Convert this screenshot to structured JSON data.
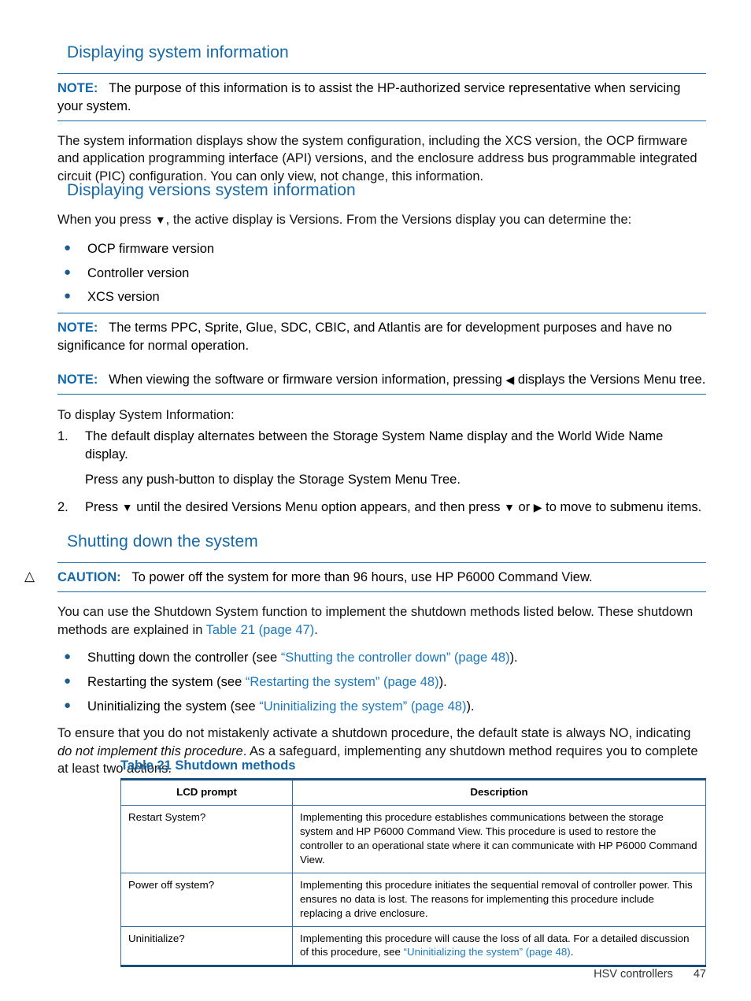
{
  "sections": [
    {
      "heading": "Displaying system information",
      "note1": {
        "label": "NOTE:",
        "text": "The purpose of this information is to assist the HP-authorized service representative when servicing your system."
      },
      "para1": "The system information displays show the system configuration, including the XCS version, the OCP firmware and application programming interface (API) versions, and the enclosure address bus programmable integrated circuit (PIC) configuration. You can only view, not change, this information."
    },
    {
      "heading": "Displaying versions system information",
      "intro_a": "When you press ",
      "intro_icon": "▼",
      "intro_b": ", the active display is Versions. From the Versions display you can determine the:",
      "bullets": [
        "OCP firmware version",
        "Controller version",
        "XCS version"
      ],
      "note2": {
        "label": "NOTE:",
        "text": "The terms PPC, Sprite, Glue, SDC, CBIC, and Atlantis are for development purposes and have no significance for normal operation."
      },
      "note3": {
        "label": "NOTE:",
        "text_a": "When viewing the software or firmware version information, pressing ",
        "icon": "◀",
        "text_b": " displays the Versions Menu tree."
      },
      "to_display": "To display System Information:",
      "steps": [
        {
          "num": "1.",
          "text": "The default display alternates between the Storage System Name display and the World Wide Name display.",
          "substep": "Press any push-button to display the Storage System Menu Tree."
        },
        {
          "num": "2.",
          "text_a": "Press ",
          "icon_down": "▼",
          "text_b": " until the desired Versions Menu option appears, and then press ",
          "icon_down2": "▼",
          "text_c": " or ",
          "icon_right": "▶",
          "text_d": " to move to submenu items."
        }
      ]
    },
    {
      "heading": "Shutting down the system",
      "caution": {
        "icon": "△",
        "label": "CAUTION:",
        "text": "To power off the system for more than 96 hours, use HP P6000 Command View."
      },
      "para_a": "You can use the Shutdown System function to implement the shutdown methods listed below. These shutdown methods are explained in ",
      "para_link": "Table 21 (page 47)",
      "para_b": ".",
      "bullets": [
        {
          "pre": "Shutting down the controller (see ",
          "link": "“Shutting the controller down” (page 48)",
          "post": ")."
        },
        {
          "pre": "Restarting the system (see ",
          "link": "“Restarting the system” (page 48)",
          "post": ")."
        },
        {
          "pre": "Uninitializing the system (see ",
          "link": "“Uninitializing the system” (page 48)",
          "post": ")."
        }
      ],
      "para2_a": "To ensure that you do not mistakenly activate a shutdown procedure, the default state is always NO, indicating ",
      "para2_ital": "do not implement this procedure",
      "para2_b": ". As a safeguard, implementing any shutdown method requires you to complete at least two actions."
    }
  ],
  "table": {
    "caption": "Table 21 Shutdown methods",
    "headers": [
      "LCD prompt",
      "Description"
    ],
    "rows": [
      {
        "prompt": "Restart System?",
        "description": "Implementing this procedure establishes communications between the storage system and HP P6000 Command View. This procedure is used to restore the controller to an operational state where it can communicate with HP P6000 Command View.",
        "link": "",
        "description_tail": ""
      },
      {
        "prompt": "Power off system?",
        "description": "Implementing this procedure initiates the sequential removal of controller power. This ensures no data is lost. The reasons for implementing this procedure include replacing a drive enclosure.",
        "link": "",
        "description_tail": ""
      },
      {
        "prompt": "Uninitialize?",
        "description": "Implementing this procedure will cause the loss of all data. For a detailed discussion of this procedure, see ",
        "link": "“Uninitializing the system” (page 48)",
        "description_tail": "."
      }
    ]
  },
  "footer": {
    "chapter": "HSV controllers",
    "page_number": "47"
  },
  "colors": {
    "heading_blue": "#1669a8",
    "link_blue": "#1b78bd",
    "rule_blue": "#1669a8",
    "table_border": "#2f6ea5",
    "table_edge": "#174e7c"
  }
}
